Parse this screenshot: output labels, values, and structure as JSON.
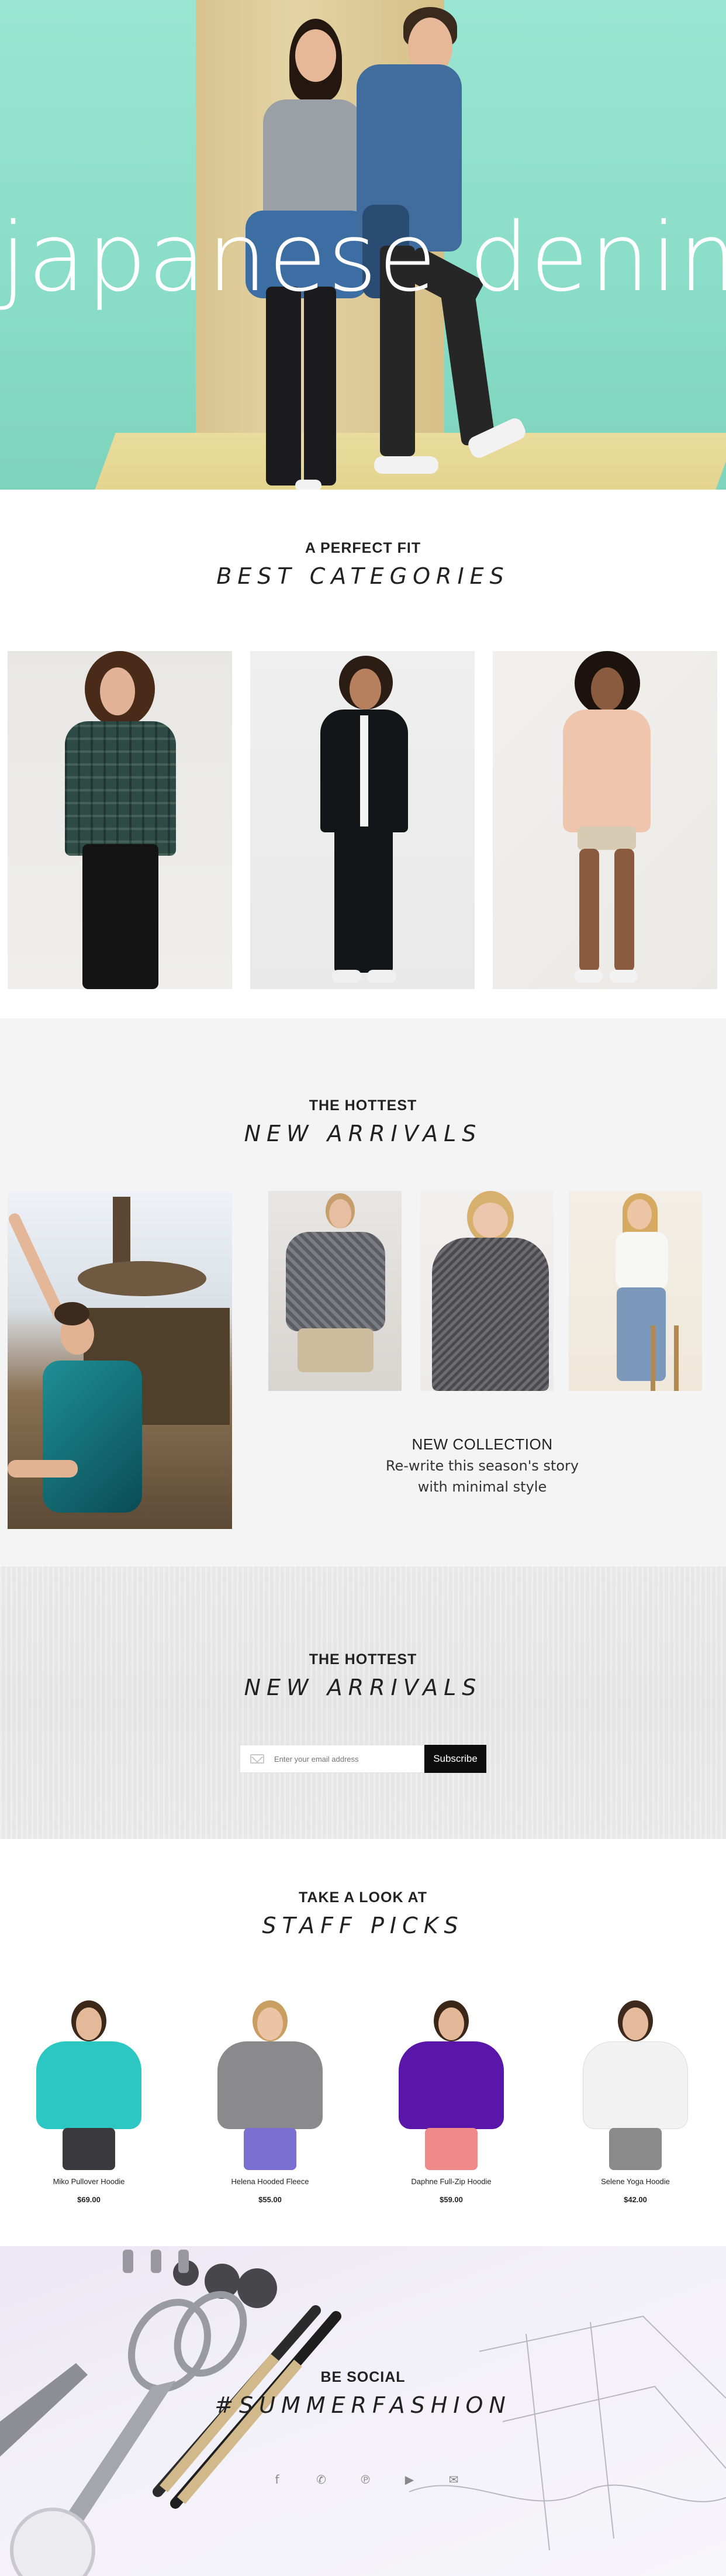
{
  "hero": {
    "title": "japanese denim"
  },
  "categories": {
    "kicker": "A PERFECT FIT",
    "heading": "BEST CATEGORIES",
    "cards": [
      {
        "id": "plaid-shirt-look"
      },
      {
        "id": "track-jacket-look"
      },
      {
        "id": "sheer-shirt-look"
      }
    ]
  },
  "arrivals": {
    "kicker": "THE HOTTEST",
    "heading": "NEW ARRIVALS",
    "collection_title": "NEW COLLECTION",
    "collection_sub": "Re-write this season's story with minimal style"
  },
  "newsletter": {
    "kicker": "THE HOTTEST",
    "heading": "NEW ARRIVALS",
    "email_placeholder": "Enter your email address",
    "subscribe_label": "Subscribe"
  },
  "staff_picks": {
    "kicker": "TAKE A LOOK AT",
    "heading": "STAFF PICKS",
    "products": [
      {
        "name": "Miko Pullover Hoodie",
        "price": "$69.00",
        "color": "#2cc7c3"
      },
      {
        "name": "Helena Hooded Fleece",
        "price": "$55.00",
        "color": "#8a8a8c"
      },
      {
        "name": "Daphne Full-Zip Hoodie",
        "price": "$59.00",
        "color": "#5a16a8"
      },
      {
        "name": "Selene Yoga Hoodie",
        "price": "$42.00",
        "color": "#f2f2f2"
      }
    ]
  },
  "social": {
    "kicker": "BE SOCIAL",
    "heading": "#SUMMERFASHION",
    "icons": [
      "facebook-icon",
      "twitter-icon",
      "pinterest-icon",
      "youtube-icon",
      "chat-icon"
    ],
    "glyphs": [
      "f",
      "✆",
      "℗",
      "▶",
      "✉"
    ]
  }
}
